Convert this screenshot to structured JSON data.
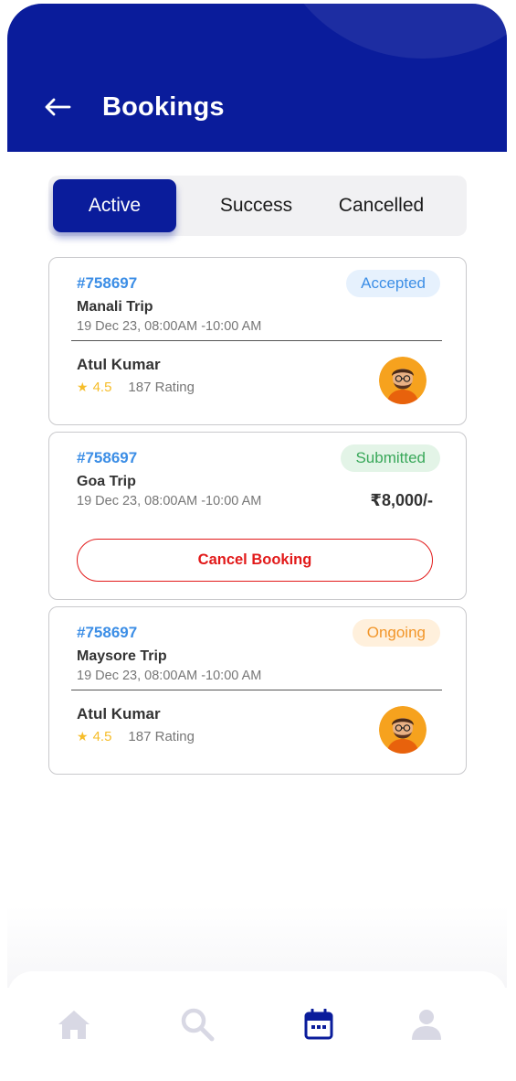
{
  "header": {
    "title": "Bookings"
  },
  "tabs": [
    {
      "label": "Active",
      "active": true
    },
    {
      "label": "Success",
      "active": false
    },
    {
      "label": "Cancelled",
      "active": false
    }
  ],
  "bookings": [
    {
      "id": "#758697",
      "trip": "Manali Trip",
      "time": "19 Dec 23, 08:00AM -10:00 AM",
      "status": "Accepted",
      "driver": {
        "name": "Atul Kumar",
        "rating": "4.5",
        "rating_count": "187 Rating"
      }
    },
    {
      "id": "#758697",
      "trip": "Goa Trip",
      "time": "19 Dec 23, 08:00AM -10:00 AM",
      "status": "Submitted",
      "price": "₹8,000/-",
      "cancel_label": "Cancel Booking"
    },
    {
      "id": "#758697",
      "trip": "Maysore Trip",
      "time": "19 Dec 23, 08:00AM -10:00 AM",
      "status": "Ongoing",
      "driver": {
        "name": "Atul Kumar",
        "rating": "4.5",
        "rating_count": "187 Rating"
      }
    }
  ],
  "nav": {
    "items": [
      {
        "icon": "home-icon",
        "active": false
      },
      {
        "icon": "search-icon",
        "active": false
      },
      {
        "icon": "calendar-icon",
        "active": true
      },
      {
        "icon": "profile-icon",
        "active": false
      }
    ]
  },
  "colors": {
    "primary": "#0a1c9b",
    "link_blue": "#3c8ee6",
    "accepted_bg": "#e6f1fd",
    "submitted": "#39a85a",
    "ongoing": "#f2962a",
    "cancel_red": "#e21a1a",
    "star": "#f6bd2a",
    "nav_inactive": "#d8d8e4"
  }
}
